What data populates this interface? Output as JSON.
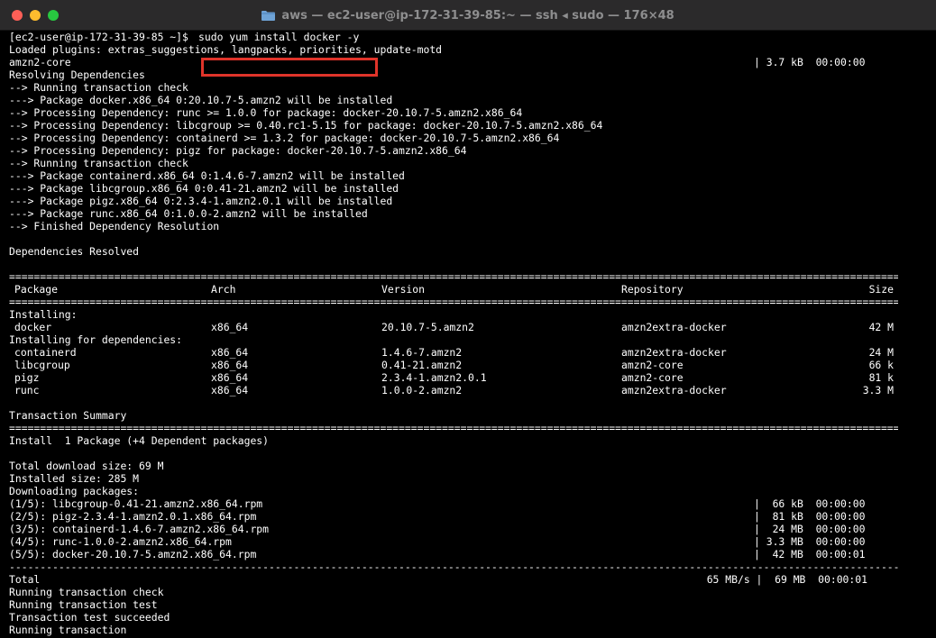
{
  "window": {
    "title": "aws — ec2-user@ip-172-31-39-85:~ — ssh ◂ sudo — 176×48",
    "folder_icon": "folder-icon"
  },
  "prompt": {
    "user_host": "[ec2-user@ip-172-31-39-85 ~]$ ",
    "command": "sudo yum install docker -y",
    "highlight_color": "#e0342a"
  },
  "pre_lines": [
    "Loaded plugins: extras_suggestions, langpacks, priorities, update-motd",
    "amzn2-core",
    "Resolving Dependencies",
    "--> Running transaction check",
    "---> Package docker.x86_64 0:20.10.7-5.amzn2 will be installed",
    "--> Processing Dependency: runc >= 1.0.0 for package: docker-20.10.7-5.amzn2.x86_64",
    "--> Processing Dependency: libcgroup >= 0.40.rc1-5.15 for package: docker-20.10.7-5.amzn2.x86_64",
    "--> Processing Dependency: containerd >= 1.3.2 for package: docker-20.10.7-5.amzn2.x86_64",
    "--> Processing Dependency: pigz for package: docker-20.10.7-5.amzn2.x86_64",
    "--> Running transaction check",
    "---> Package containerd.x86_64 0:1.4.6-7.amzn2 will be installed",
    "---> Package libcgroup.x86_64 0:0.41-21.amzn2 will be installed",
    "---> Package pigz.x86_64 0:2.3.4-1.amzn2.0.1 will be installed",
    "---> Package runc.x86_64 0:1.0.0-2.amzn2 will be installed",
    "--> Finished Dependency Resolution",
    "",
    "Dependencies Resolved",
    ""
  ],
  "amzn2_core_meta": "| 3.7 kB  00:00:00",
  "table": {
    "headers": {
      "package": "Package",
      "arch": "Arch",
      "version": "Version",
      "repository": "Repository",
      "size": "Size"
    },
    "installing_label": "Installing:",
    "installing": [
      {
        "package": "docker",
        "arch": "x86_64",
        "version": "20.10.7-5.amzn2",
        "repository": "amzn2extra-docker",
        "size": "42 M"
      }
    ],
    "deps_label": "Installing for dependencies:",
    "dependencies": [
      {
        "package": "containerd",
        "arch": "x86_64",
        "version": "1.4.6-7.amzn2",
        "repository": "amzn2extra-docker",
        "size": "24 M"
      },
      {
        "package": "libcgroup",
        "arch": "x86_64",
        "version": "0.41-21.amzn2",
        "repository": "amzn2-core",
        "size": "66 k"
      },
      {
        "package": "pigz",
        "arch": "x86_64",
        "version": "2.3.4-1.amzn2.0.1",
        "repository": "amzn2-core",
        "size": "81 k"
      },
      {
        "package": "runc",
        "arch": "x86_64",
        "version": "1.0.0-2.amzn2",
        "repository": "amzn2extra-docker",
        "size": "3.3 M"
      }
    ]
  },
  "summary": {
    "title": "Transaction Summary",
    "install_line": "Install  1 Package (+4 Dependent packages)",
    "total_download": "Total download size: 69 M",
    "installed_size": "Installed size: 285 M",
    "downloading": "Downloading packages:"
  },
  "downloads": [
    {
      "file": "(1/5): libcgroup-0.41-21.amzn2.x86_64.rpm",
      "meta": "|  66 kB  00:00:00"
    },
    {
      "file": "(2/5): pigz-2.3.4-1.amzn2.0.1.x86_64.rpm",
      "meta": "|  81 kB  00:00:00"
    },
    {
      "file": "(3/5): containerd-1.4.6-7.amzn2.x86_64.rpm",
      "meta": "|  24 MB  00:00:00"
    },
    {
      "file": "(4/5): runc-1.0.0-2.amzn2.x86_64.rpm",
      "meta": "| 3.3 MB  00:00:00"
    },
    {
      "file": "(5/5): docker-20.10.7-5.amzn2.x86_64.rpm",
      "meta": "|  42 MB  00:00:01"
    }
  ],
  "total": {
    "label": "Total",
    "meta": "65 MB/s |  69 MB  00:00:01"
  },
  "post_lines": [
    "Running transaction check",
    "Running transaction test",
    "Transaction test succeeded",
    "Running transaction"
  ],
  "rules": {
    "double": "================================================================================================================================================================================",
    "single": "--------------------------------------------------------------------------------------------------------------------------------------------------------------------------------"
  }
}
